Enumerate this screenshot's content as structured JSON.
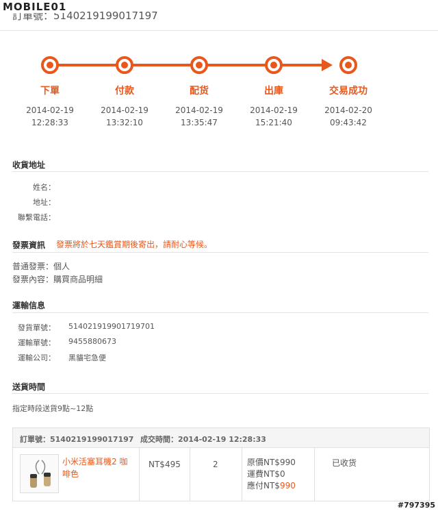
{
  "watermark": {
    "brand": "MOBILE01",
    "tag": "#797395"
  },
  "order": {
    "header": "訂單號：5140219199017197"
  },
  "progress": {
    "steps": [
      {
        "label": "下單",
        "date": "2014-02-19",
        "time": "12:28:33"
      },
      {
        "label": "付款",
        "date": "2014-02-19",
        "time": "13:32:10"
      },
      {
        "label": "配货",
        "date": "2014-02-19",
        "time": "13:35:47"
      },
      {
        "label": "出庫",
        "date": "2014-02-19",
        "time": "15:21:40"
      },
      {
        "label": "交易成功",
        "date": "2014-02-20",
        "time": "09:43:42"
      }
    ]
  },
  "address": {
    "title": "收貨地址",
    "name_label": "姓名：",
    "address_label": "地址：",
    "phone_label": "聯繫電話："
  },
  "invoice": {
    "title": "發票資訊",
    "notice": "發票將於七天鑑賞期後寄出，請耐心等候。",
    "type_line": "普通發票：個人",
    "content_line": "發票內容：購買商品明細"
  },
  "shipping": {
    "title": "運輸信息",
    "rows": [
      {
        "label": "發貨單號：",
        "value": "514021919901719701"
      },
      {
        "label": "運輸單號：",
        "value": "9455880673"
      },
      {
        "label": "運輸公司：",
        "value": "黑貓宅急便"
      }
    ]
  },
  "delivery": {
    "title": "送貨時間",
    "text": "指定時段送貨9點~12點"
  },
  "order_box": {
    "order_no": "訂單號：5140219199017197",
    "deal_time": "成交時間：2014-02-19 12:28:33",
    "product_name": "小米活塞耳機2 咖啡色",
    "price": "NT$495",
    "qty": "2",
    "original_price": "原價NT$990",
    "shipping_fee": "運費NT$0",
    "pay_label": "應付NT$",
    "pay_amount": "990",
    "status": "已收货"
  },
  "colors": {
    "accent": "#e8581c"
  }
}
